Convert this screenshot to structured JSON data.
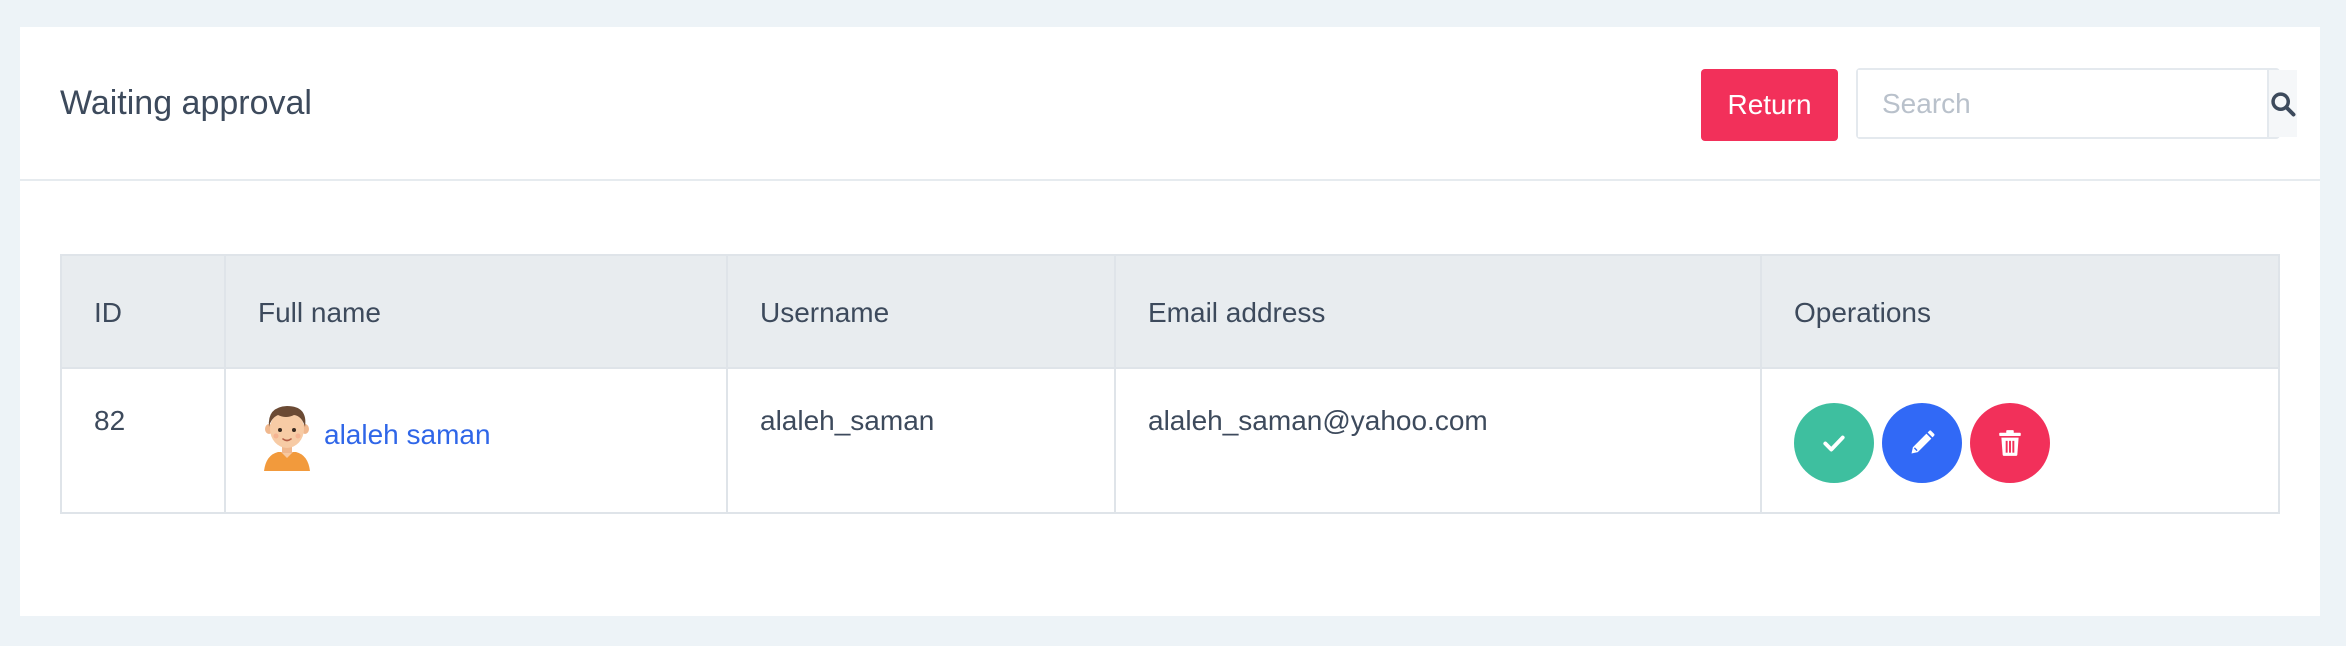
{
  "header": {
    "title": "Waiting approval",
    "return_label": "Return",
    "search": {
      "placeholder": "Search",
      "value": "",
      "icon": "search-icon"
    }
  },
  "table": {
    "columns": [
      "ID",
      "Full name",
      "Username",
      "Email address",
      "Operations"
    ],
    "rows": [
      {
        "id": "82",
        "full_name": "alaleh saman",
        "avatar": "boy-avatar",
        "username": "alaleh_saman",
        "email": "alaleh_saman@yahoo.com",
        "operations": [
          {
            "name": "approve",
            "icon": "check-icon",
            "color": "#3ebf9f"
          },
          {
            "name": "edit",
            "icon": "pencil-icon",
            "color": "#3169f6"
          },
          {
            "name": "delete",
            "icon": "trash-icon",
            "color": "#f2305a"
          }
        ]
      }
    ]
  },
  "colors": {
    "page_background": "#edf3f7",
    "accent_red": "#f2305a",
    "link_blue": "#2f66e8",
    "approve_green": "#3ebf9f",
    "edit_blue": "#3169f6"
  }
}
